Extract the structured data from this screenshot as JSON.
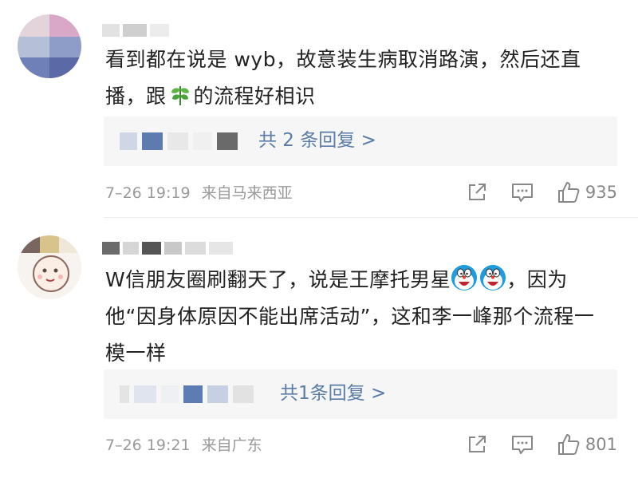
{
  "comments": [
    {
      "text_before_icon": "看到都在说是 wyb，故意装生病取消路演，然后还直播，跟",
      "icon": "leaf-emoji",
      "text_after_icon": "的流程好相识",
      "reply_link": "共 2 条回复 >",
      "date": "7–26 19:19",
      "source": "来自马来西亚",
      "likes": "935"
    },
    {
      "text_before_icon": "W信朋友圈刷翻天了，说是王摩托男星",
      "icon": "doraemon-emoji",
      "text_after_icon": "，因为他“因身体原因不能出席活动”，这和李一峰那个流程一模一样",
      "reply_link": "共1条回复 >",
      "date": "7–26 19:21",
      "source": "来自广东",
      "likes": "801"
    }
  ],
  "colors": {
    "link": "#5a7ca8",
    "meta": "#9a9a9a",
    "reply_bg": "#f6f6f6"
  },
  "icons": {
    "share": "share-icon",
    "comment": "comment-icon",
    "like": "thumbs-up-icon"
  }
}
